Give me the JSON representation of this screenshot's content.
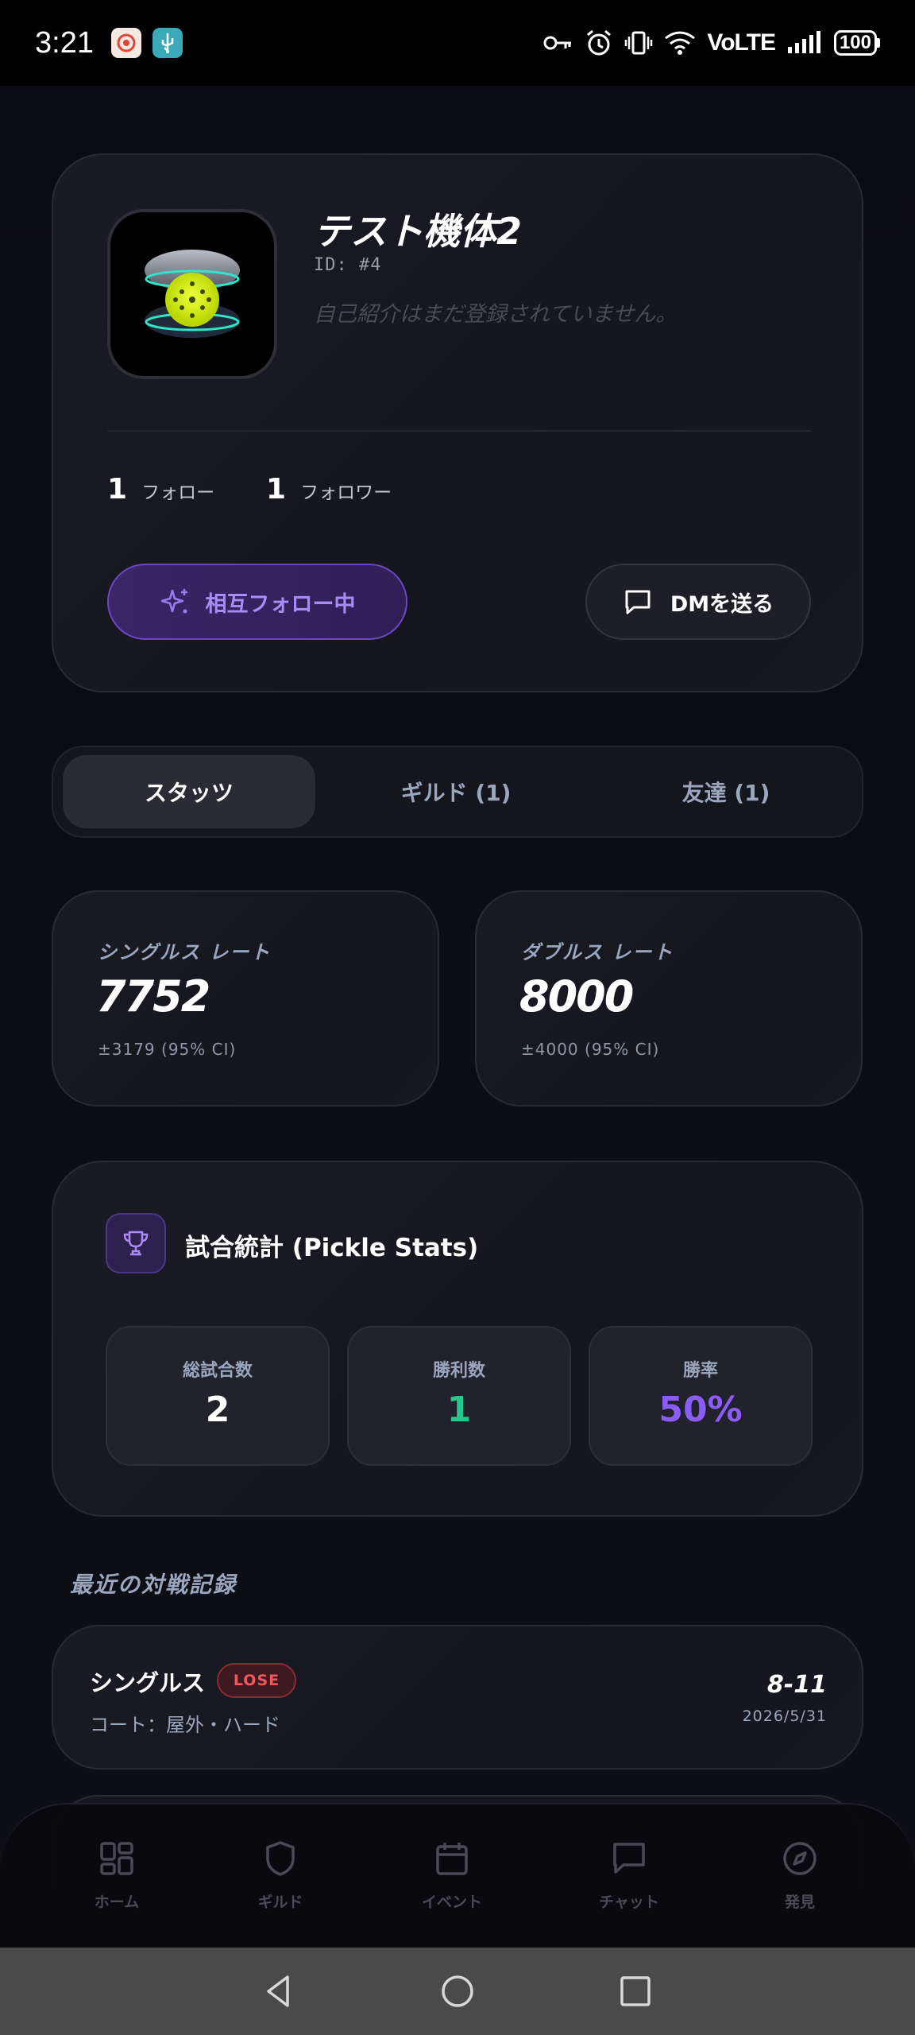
{
  "status_bar": {
    "time": "3:21",
    "network": "VoLTE",
    "battery": "100"
  },
  "profile": {
    "name": "テスト機体2",
    "id": "ID: #4",
    "bio": "自己紹介はまだ登録されていません。",
    "following_count": "1",
    "following_label": "フォロー",
    "followers_count": "1",
    "followers_label": "フォロワー",
    "mutual_button": "相互フォロー中",
    "dm_button": "DMを送る"
  },
  "tabs": [
    {
      "label": "スタッツ",
      "active": true
    },
    {
      "label": "ギルド (1)",
      "active": false
    },
    {
      "label": "友達 (1)",
      "active": false
    }
  ],
  "ratings": {
    "singles": {
      "label": "シングルス レート",
      "value": "7752",
      "ci": "±3179 (95% CI)"
    },
    "doubles": {
      "label": "ダブルス レート",
      "value": "8000",
      "ci": "±4000 (95% CI)"
    }
  },
  "stats": {
    "title": "試合統計 (Pickle Stats)",
    "total_label": "総試合数",
    "total_value": "2",
    "wins_label": "勝利数",
    "wins_value": "1",
    "winrate_label": "勝率",
    "winrate_value": "50%",
    "colors": {
      "wins": "#22c98a",
      "winrate": "#8b5cf6"
    }
  },
  "recent": {
    "heading": "最近の対戦記録",
    "matches": [
      {
        "type": "シングルス",
        "result": "LOSE",
        "court": "コート：屋外・ハード",
        "score": "8-11",
        "date": "2026/5/31"
      }
    ]
  },
  "bottom_nav": [
    {
      "label": "ホーム",
      "icon": "grid-icon"
    },
    {
      "label": "ギルド",
      "icon": "shield-icon"
    },
    {
      "label": "イベント",
      "icon": "calendar-icon"
    },
    {
      "label": "チャット",
      "icon": "chat-icon"
    },
    {
      "label": "発見",
      "icon": "compass-icon"
    }
  ],
  "accent": "#7c4dff"
}
